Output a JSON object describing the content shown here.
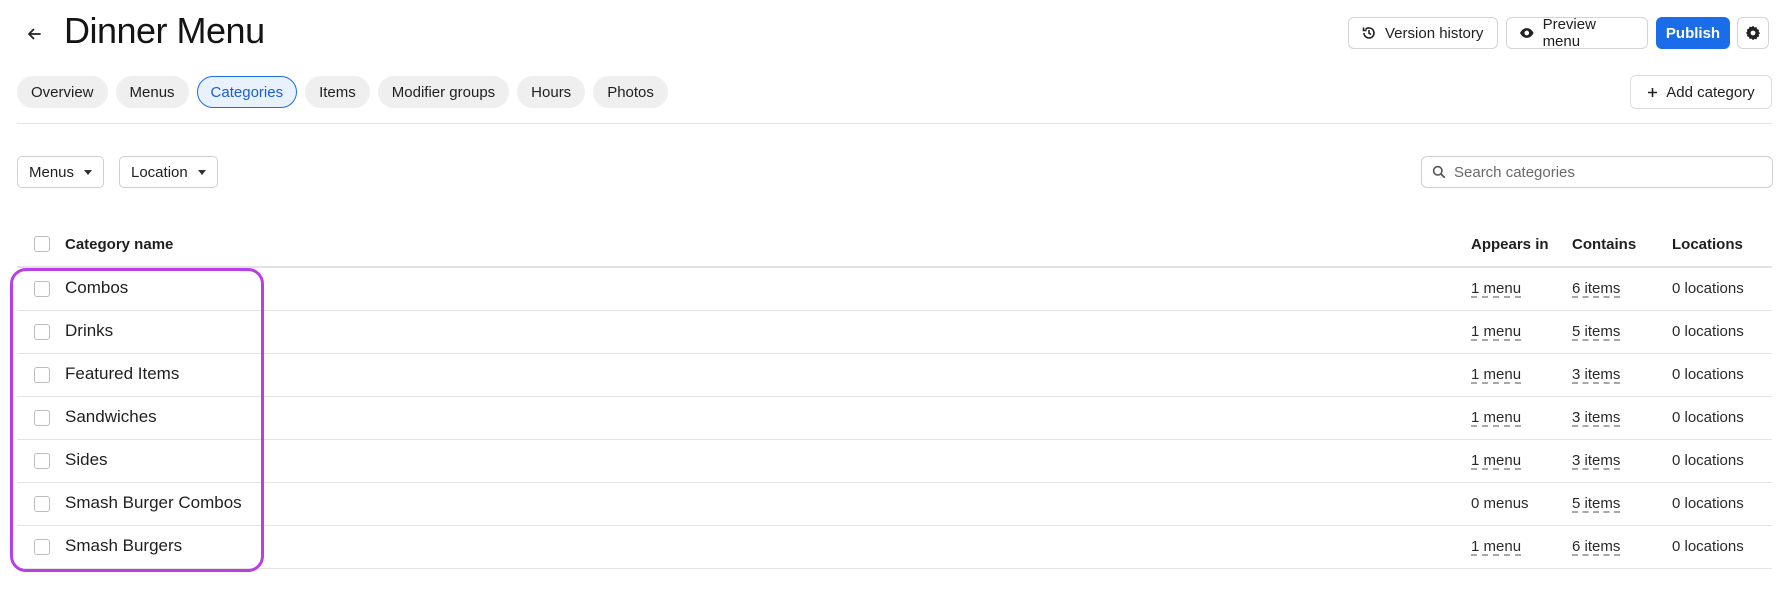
{
  "header": {
    "title": "Dinner Menu",
    "version_history_label": "Version history",
    "preview_label": "Preview menu",
    "publish_label": "Publish"
  },
  "tabs": [
    {
      "label": "Overview",
      "active": false
    },
    {
      "label": "Menus",
      "active": false
    },
    {
      "label": "Categories",
      "active": true
    },
    {
      "label": "Items",
      "active": false
    },
    {
      "label": "Modifier groups",
      "active": false
    },
    {
      "label": "Hours",
      "active": false
    },
    {
      "label": "Photos",
      "active": false
    }
  ],
  "add_category_label": "Add category",
  "filters": {
    "menus_label": "Menus",
    "location_label": "Location"
  },
  "search": {
    "placeholder": "Search categories"
  },
  "table": {
    "columns": {
      "name": "Category name",
      "appears_in": "Appears in",
      "contains": "Contains",
      "locations": "Locations"
    },
    "rows": [
      {
        "name": "Combos",
        "appears_in": "1 menu",
        "contains": "6 items",
        "locations": "0 locations"
      },
      {
        "name": "Drinks",
        "appears_in": "1 menu",
        "contains": "5 items",
        "locations": "0 locations"
      },
      {
        "name": "Featured Items",
        "appears_in": "1 menu",
        "contains": "3 items",
        "locations": "0 locations"
      },
      {
        "name": "Sandwiches",
        "appears_in": "1 menu",
        "contains": "3 items",
        "locations": "0 locations"
      },
      {
        "name": "Sides",
        "appears_in": "1 menu",
        "contains": "3 items",
        "locations": "0 locations"
      },
      {
        "name": "Smash Burger Combos",
        "appears_in": "0 menus",
        "contains": "5 items",
        "locations": "0 locations"
      },
      {
        "name": "Smash Burgers",
        "appears_in": "1 menu",
        "contains": "6 items",
        "locations": "0 locations"
      }
    ]
  },
  "colors": {
    "accent": "#1a6ce8",
    "highlight": "#b93ee6"
  }
}
